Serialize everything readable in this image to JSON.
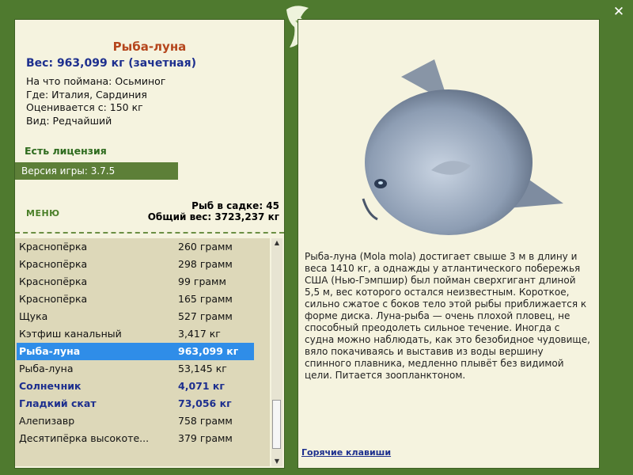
{
  "fish": {
    "name": "Рыба-луна",
    "weight": "Вес: 963,099 кг (зачетная)",
    "bait": "На что поймана: Осьминог",
    "location": "Где: Италия, Сардиния",
    "rated_from": "Оценивается с: 150 кг",
    "type": "Вид: Редчайший",
    "license": "Есть лицензия",
    "description": "Рыба-луна (Mola mola) достигает свыше 3 м в длину и веса 1410 кг, а однажды у атлантического побережья США (Нью-Гэмпшир) был пойман сверхгигант длиной 5,5 м, вес которого остался неизвестным. Короткое, сильно сжатое с боков тело этой рыбы приближается к форме диска. Луна-рыба — очень плохой пловец, не способный преодолеть сильное течение. Иногда с судна можно наблюдать, как это безобидное чудовище, вяло покачиваясь и выставив из воды вершину спинного плавника, медленно плывёт без видимой цели. Питается зоопланктоном."
  },
  "version": "Версия игры: 3.7.5",
  "menu_label": "МЕНЮ",
  "stats": {
    "fish_in_net": "Рыб в садке: 45",
    "total_weight": "Общий вес: 3723,237 кг"
  },
  "list": [
    {
      "name": "Краснопёрка",
      "weight": "260 грамм"
    },
    {
      "name": "Краснопёрка",
      "weight": "298 грамм"
    },
    {
      "name": "Краснопёрка",
      "weight": "99 грамм"
    },
    {
      "name": "Краснопёрка",
      "weight": "165 грамм"
    },
    {
      "name": "Щука",
      "weight": "527 грамм"
    },
    {
      "name": "Кэтфиш канальный",
      "weight": "3,417 кг"
    },
    {
      "name": "Рыба-луна",
      "weight": "963,099 кг"
    },
    {
      "name": "Рыба-луна",
      "weight": "53,145 кг"
    },
    {
      "name": "Солнечник",
      "weight": "4,071 кг"
    },
    {
      "name": "Гладкий скат",
      "weight": "73,056 кг"
    },
    {
      "name": "Алепизавр",
      "weight": "758 грамм"
    },
    {
      "name": "Десятипёрка высокоте...",
      "weight": "379 грамм"
    }
  ],
  "hotkeys": "Горячие клавиши",
  "icons": {
    "close": "close-icon",
    "logo": "fish-logo-icon"
  }
}
